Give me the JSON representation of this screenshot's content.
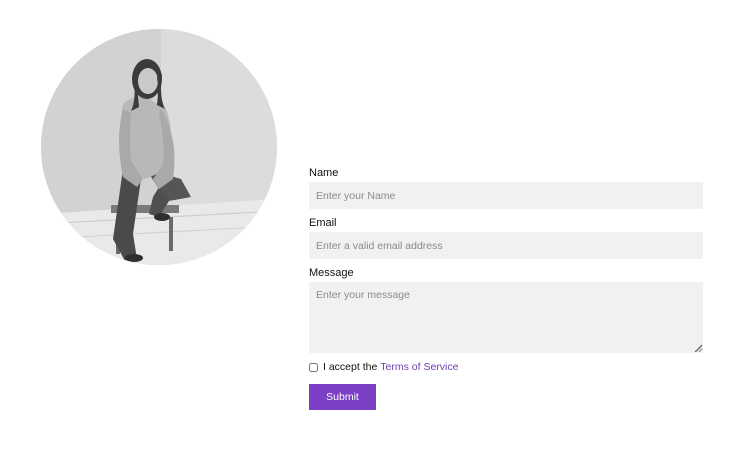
{
  "portrait": {
    "image": "black-and-white photo of a woman seated on a stool"
  },
  "form": {
    "name": {
      "label": "Name",
      "placeholder": "Enter your Name"
    },
    "email": {
      "label": "Email",
      "placeholder": "Enter a valid email address"
    },
    "message": {
      "label": "Message",
      "placeholder": "Enter your message"
    },
    "terms": {
      "prefix": "I accept the",
      "link": "Terms of Service",
      "checked": false
    },
    "submit_label": "Submit"
  },
  "colors": {
    "accent": "#7a3fc4",
    "link": "#6e3fb3",
    "input_bg": "#f1f1f1"
  }
}
